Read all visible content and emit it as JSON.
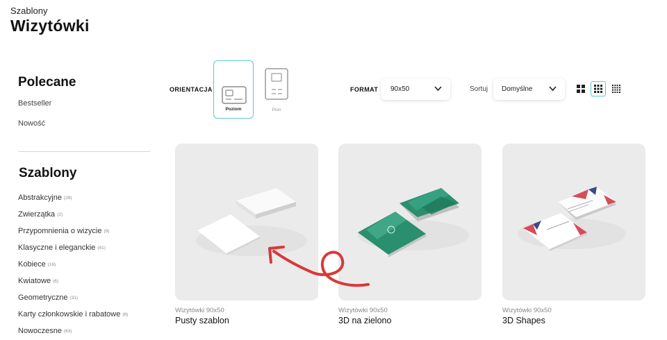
{
  "header": {
    "sup": "Szablony",
    "title": "Wizytówki"
  },
  "sidebar": {
    "featured_heading": "Polecane",
    "featured_links": [
      "Bestseller",
      "Nowość"
    ],
    "templates_heading": "Szablony",
    "categories": [
      {
        "label": "Abstrakcyjne",
        "count": "(28)"
      },
      {
        "label": "Zwierzątka",
        "count": "(2)"
      },
      {
        "label": "Przypomnienia o wizycie",
        "count": "(9)"
      },
      {
        "label": "Klasyczne i eleganckie",
        "count": "(41)"
      },
      {
        "label": "Kobiece",
        "count": "(16)"
      },
      {
        "label": "Kwiatowe",
        "count": "(6)"
      },
      {
        "label": "Geometryczne",
        "count": "(31)"
      },
      {
        "label": "Karty członkowskie i rabatowe",
        "count": "(6)"
      },
      {
        "label": "Nowoczesne",
        "count": "(63)"
      }
    ]
  },
  "toolbar": {
    "orientation_label": "ORIENTACJA",
    "orientation_options": [
      "Poziom",
      "Pion"
    ],
    "orientation_selected": "Poziom",
    "format_label": "FORMAT",
    "format_value": "90x50",
    "sort_label": "Sortuj",
    "sort_value": "Domyślne",
    "view_selected": "grid-medium"
  },
  "products": [
    {
      "format": "Wizytówki 90x50",
      "name": "Pusty szablon"
    },
    {
      "format": "Wizytówki 90x50",
      "name": "3D na zielono"
    },
    {
      "format": "Wizytówki 90x50",
      "name": "3D Shapes"
    }
  ],
  "colors": {
    "accent": "#5cc6d8",
    "arrow": "#d93838",
    "card_bg": "#ebebeb",
    "green_card": "#2a8f6e"
  }
}
